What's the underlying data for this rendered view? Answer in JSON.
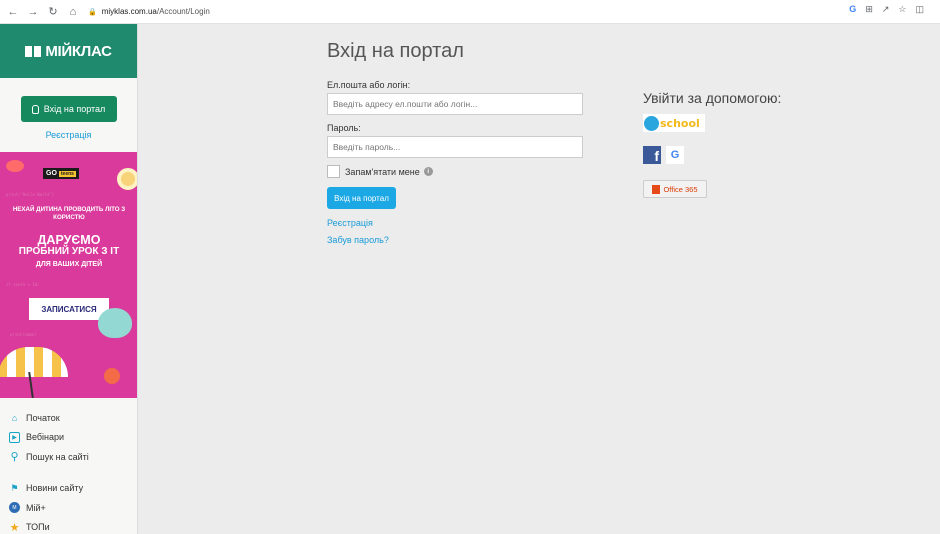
{
  "browser": {
    "url_host": "miyklas.com.ua",
    "url_path": "/Account/Login",
    "nav_icons": [
      "back-icon",
      "forward-icon",
      "reload-icon",
      "home-icon"
    ],
    "right_icons": [
      "google-icon",
      "install-icon",
      "share-icon",
      "star-icon",
      "extensions-icon"
    ]
  },
  "sidebar": {
    "logo_text": "МІЙКЛАС",
    "login_label": "Вхід на портал",
    "register_label": "Реєстрація",
    "promo": {
      "go_label": "GO",
      "teens_label": "teens",
      "headline": "НЕХАЙ ДИТИНА ПРОВОДИТЬ ЛІТО З КОРИСТЮ",
      "offer_line1": "ДАРУЄМО",
      "offer_line2": "ПРОБНИЙ УРОК З ІТ",
      "offer_line3": "ДЛЯ ВАШИХ ДІТЕЙ",
      "cta": "ЗАПИСАТИСЯ"
    },
    "menu_items": [
      {
        "label": "Початок",
        "icon": "home-icon",
        "color": "#1aa3c8"
      },
      {
        "label": "Вебінари",
        "icon": "play-icon",
        "color": "#1aa3c8"
      },
      {
        "label": "Пошук на сайті",
        "icon": "search-icon",
        "color": "#1aa3c8"
      },
      {
        "label": "Новини сайту",
        "icon": "megaphone-icon",
        "color": "#1aa3c8"
      },
      {
        "label": "Мій+",
        "icon": "myplus-icon",
        "color": "#2e6db4"
      },
      {
        "label": "ТОПи",
        "icon": "star-icon",
        "color": "#f2a91a"
      }
    ]
  },
  "form": {
    "title": "Вхід на портал",
    "login_label": "Ел.пошта або логін:",
    "login_placeholder": "Введіть адресу ел.пошти або логін...",
    "password_label": "Пароль:",
    "password_placeholder": "Введіть пароль...",
    "remember_label": "Запам'ятати мене",
    "submit_label": "Вхід на портал",
    "register_link": "Реєстрація",
    "forgot_link": "Забув пароль?"
  },
  "social": {
    "title": "Увійти за допомогою:",
    "school_label": "school",
    "facebook_glyph": "f",
    "google_glyph": "G",
    "office_label": "Office 365"
  },
  "colors": {
    "brand": "#1f8a6e",
    "primary_button": "#1ba8e5",
    "link": "#1a9bd7",
    "promo_bg": "#d93a9b"
  }
}
